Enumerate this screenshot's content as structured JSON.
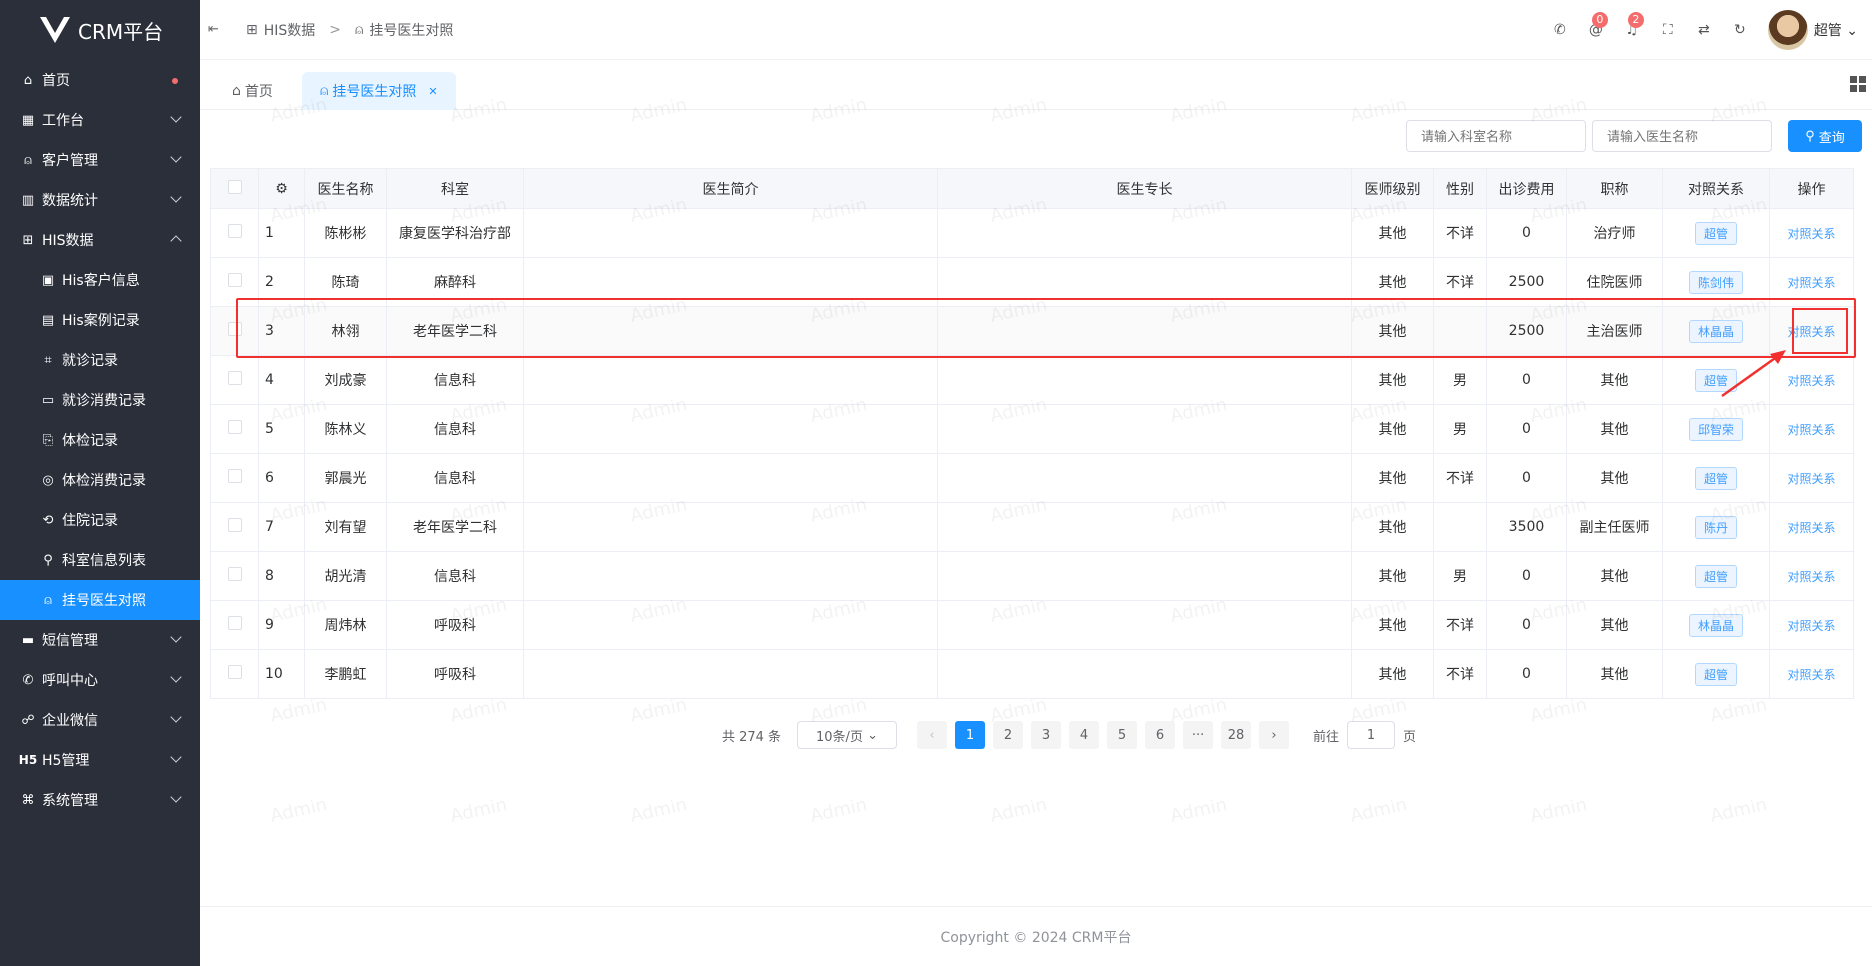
{
  "app": {
    "title": "CRM平台"
  },
  "sidebar": {
    "items": [
      {
        "label": "首页",
        "icon": "home-icon"
      },
      {
        "label": "工作台",
        "icon": "briefcase-icon"
      },
      {
        "label": "客户管理",
        "icon": "user-icon"
      },
      {
        "label": "数据统计",
        "icon": "bar-chart-icon"
      },
      {
        "label": "HIS数据",
        "icon": "medical-kit-icon"
      }
    ],
    "his_sub": [
      {
        "label": "His客户信息"
      },
      {
        "label": "His案例记录"
      },
      {
        "label": "就诊记录"
      },
      {
        "label": "就诊消费记录"
      },
      {
        "label": "体检记录"
      },
      {
        "label": "体检消费记录"
      },
      {
        "label": "住院记录"
      },
      {
        "label": "科室信息列表"
      },
      {
        "label": "挂号医生对照"
      }
    ],
    "after": [
      {
        "label": "短信管理"
      },
      {
        "label": "呼叫中心"
      },
      {
        "label": "企业微信"
      },
      {
        "label": "H5管理"
      },
      {
        "label": "系统管理"
      }
    ]
  },
  "header": {
    "crumb1": "HIS数据",
    "crumb2": "挂号医生对照",
    "badge_mail": "0",
    "badge_bell": "2",
    "user": "超管"
  },
  "tabs": {
    "home": "首页",
    "current": "挂号医生对照"
  },
  "search": {
    "dept_placeholder": "请输入科室名称",
    "doctor_placeholder": "请输入医生名称",
    "query": "查询"
  },
  "table": {
    "headers": [
      "医生名称",
      "科室",
      "医生简介",
      "医生专长",
      "医师级别",
      "性别",
      "出诊费用",
      "职称",
      "对照关系",
      "操作"
    ],
    "rows": [
      {
        "no": "1",
        "name": "陈彬彬",
        "dept": "康复医学科治疗部",
        "level": "其他",
        "sex": "不详",
        "fee": "0",
        "title": "治疗师",
        "rel": "超管",
        "op": "对照关系"
      },
      {
        "no": "2",
        "name": "陈琦",
        "dept": "麻醉科",
        "level": "其他",
        "sex": "不详",
        "fee": "2500",
        "title": "住院医师",
        "rel": "陈剑伟",
        "op": "对照关系"
      },
      {
        "no": "3",
        "name": "林翎",
        "dept": "老年医学二科",
        "level": "其他",
        "sex": "",
        "fee": "2500",
        "title": "主治医师",
        "rel": "林晶晶",
        "op": "对照关系"
      },
      {
        "no": "4",
        "name": "刘成豪",
        "dept": "信息科",
        "level": "其他",
        "sex": "男",
        "fee": "0",
        "title": "其他",
        "rel": "超管",
        "op": "对照关系"
      },
      {
        "no": "5",
        "name": "陈林义",
        "dept": "信息科",
        "level": "其他",
        "sex": "男",
        "fee": "0",
        "title": "其他",
        "rel": "邱智荣",
        "op": "对照关系"
      },
      {
        "no": "6",
        "name": "郭晨光",
        "dept": "信息科",
        "level": "其他",
        "sex": "不详",
        "fee": "0",
        "title": "其他",
        "rel": "超管",
        "op": "对照关系"
      },
      {
        "no": "7",
        "name": "刘有望",
        "dept": "老年医学二科",
        "level": "其他",
        "sex": "",
        "fee": "3500",
        "title": "副主任医师",
        "rel": "陈丹",
        "op": "对照关系"
      },
      {
        "no": "8",
        "name": "胡光清",
        "dept": "信息科",
        "level": "其他",
        "sex": "男",
        "fee": "0",
        "title": "其他",
        "rel": "超管",
        "op": "对照关系"
      },
      {
        "no": "9",
        "name": "周炜林",
        "dept": "呼吸科",
        "level": "其他",
        "sex": "不详",
        "fee": "0",
        "title": "其他",
        "rel": "林晶晶",
        "op": "对照关系"
      },
      {
        "no": "10",
        "name": "李鹏虹",
        "dept": "呼吸科",
        "level": "其他",
        "sex": "不详",
        "fee": "0",
        "title": "其他",
        "rel": "超管",
        "op": "对照关系"
      }
    ]
  },
  "pager": {
    "total": "共 274 条",
    "size": "10条/页",
    "pages": [
      "1",
      "2",
      "3",
      "4",
      "5",
      "6",
      "···",
      "28"
    ],
    "goto": "前往",
    "page": "1",
    "unit": "页"
  },
  "footer": {
    "copyright": "Copyright © 2024 CRM平台"
  },
  "watermark": "Admin"
}
